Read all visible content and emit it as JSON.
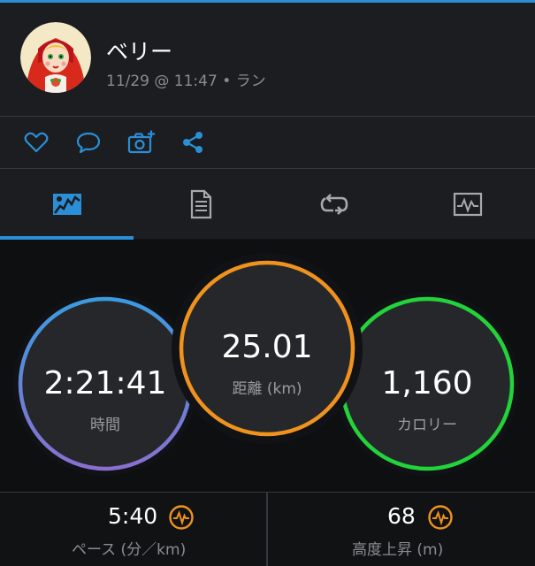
{
  "activity": {
    "user_name": "ベリー",
    "meta": "11/29 @ 11:47 • ラン"
  },
  "actions": {
    "like_icon": "heart-icon",
    "comment_icon": "comment-icon",
    "add_photo_icon": "add-photo-icon",
    "share_icon": "share-icon"
  },
  "tabs": [
    {
      "icon": "map-icon",
      "active": true
    },
    {
      "icon": "document-icon",
      "active": false
    },
    {
      "icon": "laps-icon",
      "active": false
    },
    {
      "icon": "chart-icon",
      "active": false
    }
  ],
  "stats": {
    "time": {
      "value": "2:21:41",
      "label": "時間"
    },
    "distance": {
      "value": "25.01",
      "label": "距離 (km)"
    },
    "calories": {
      "value": "1,160",
      "label": "カロリー"
    }
  },
  "metrics": {
    "pace": {
      "value": "5:40",
      "label": "ペース (分／km)"
    },
    "elevation": {
      "value": "68",
      "label": "高度上昇 (m)"
    }
  },
  "colors": {
    "accent": "#2a8fd6",
    "distance_ring": "#f0921e",
    "calories_ring": "#22d33a",
    "time_ring_top": "#3b9be0",
    "time_ring_bottom": "#8a6fd0",
    "gauge": "#f0921e"
  }
}
